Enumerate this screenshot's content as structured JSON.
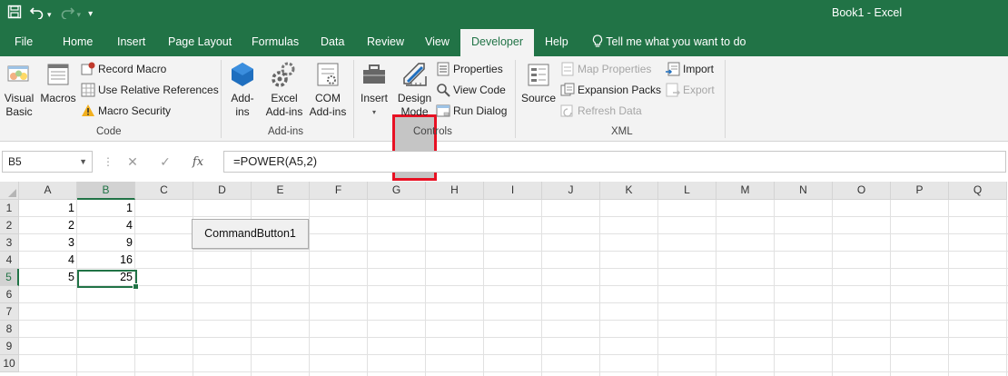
{
  "titlebar": {
    "title": "Book1  -  Excel",
    "qat": {
      "save_icon": "save-icon",
      "undo_icon": "undo-icon",
      "redo_icon": "redo-icon",
      "customize_icon": "customize-qat-icon"
    }
  },
  "tabs": [
    "File",
    "Home",
    "Insert",
    "Page Layout",
    "Formulas",
    "Data",
    "Review",
    "View",
    "Developer",
    "Help"
  ],
  "tell_me": "Tell me what you want to do",
  "ribbon": {
    "code": {
      "label": "Code",
      "visual_basic": [
        "Visual",
        "Basic"
      ],
      "macros": "Macros",
      "record_macro": "Record Macro",
      "relative_refs": "Use Relative References",
      "macro_security": "Macro Security"
    },
    "addins": {
      "label": "Add-ins",
      "addins_btn": [
        "Add-",
        "ins"
      ],
      "excel_addins": [
        "Excel",
        "Add-ins"
      ],
      "com_addins": [
        "COM",
        "Add-ins"
      ]
    },
    "controls": {
      "label": "Controls",
      "insert": "Insert",
      "design_mode": [
        "Design",
        "Mode"
      ],
      "properties": "Properties",
      "view_code": "View Code",
      "run_dialog": "Run Dialog"
    },
    "xml": {
      "label": "XML",
      "source": "Source",
      "map_properties": "Map Properties",
      "expansion_packs": "Expansion Packs",
      "refresh_data": "Refresh Data",
      "import": "Import",
      "export": "Export"
    }
  },
  "formula_bar": {
    "name_box": "B5",
    "cancel_glyph": "✕",
    "enter_glyph": "✓",
    "fx": "fx",
    "formula": "=POWER(A5,2)"
  },
  "grid": {
    "columns": [
      "A",
      "B",
      "C",
      "D",
      "E",
      "F",
      "G",
      "H",
      "I",
      "J",
      "K",
      "L",
      "M",
      "N",
      "O",
      "P",
      "Q"
    ],
    "rows": [
      "1",
      "2",
      "3",
      "4",
      "5",
      "6",
      "7",
      "8",
      "9",
      "10"
    ],
    "col_a": [
      "1",
      "2",
      "3",
      "4",
      "5"
    ],
    "col_b": [
      "1",
      "4",
      "9",
      "16",
      "25"
    ]
  },
  "command_button": "CommandButton1",
  "colors": {
    "excel_green": "#217346",
    "highlight": "#e81123"
  }
}
